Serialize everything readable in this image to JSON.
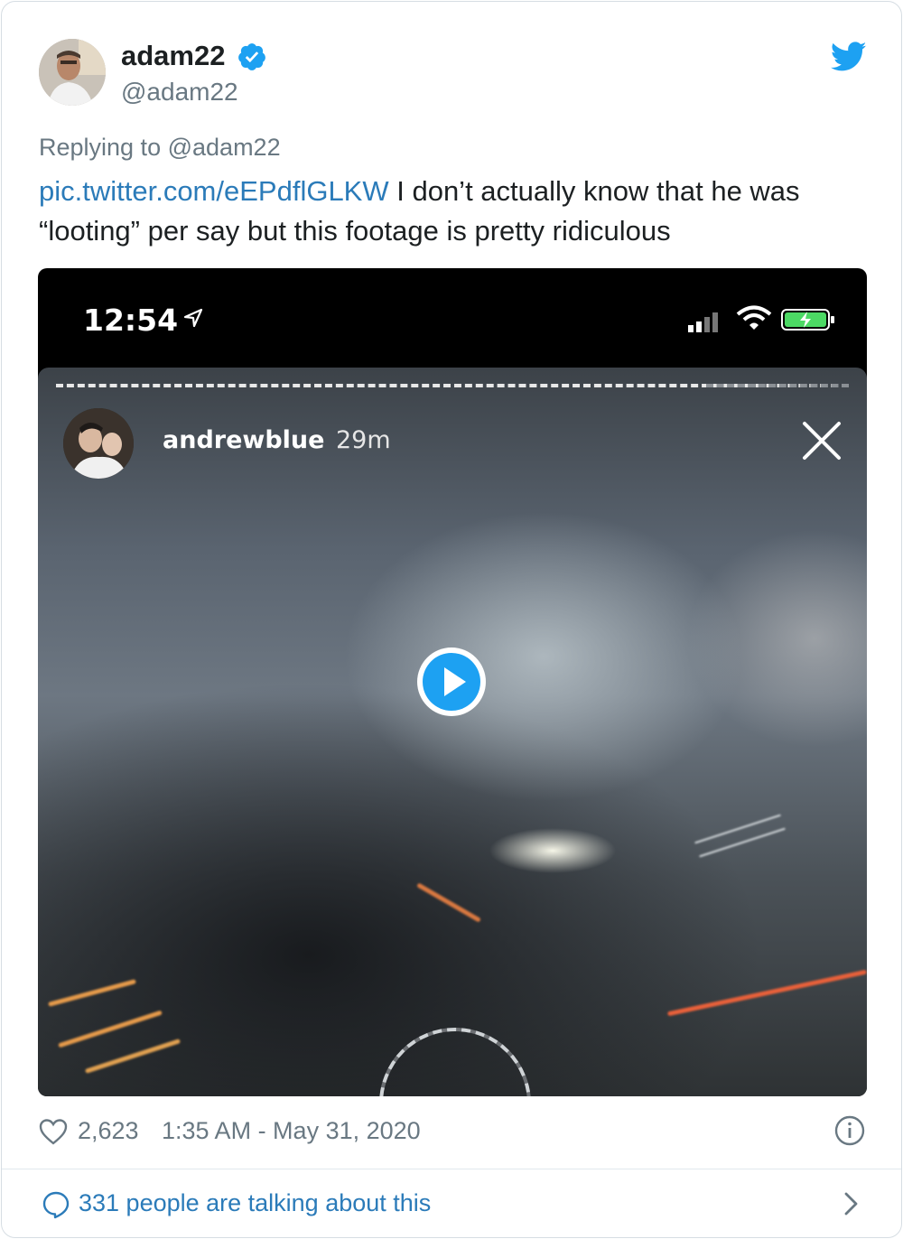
{
  "author": {
    "name": "adam22",
    "handle": "@adam22",
    "verified": true
  },
  "reply": {
    "prefix": "Replying to",
    "to": "@adam22"
  },
  "tweet": {
    "link": "pic.twitter.com/eEPdflGLKW",
    "text_line1": " I don’t actually know that he was",
    "text_line2": "“looting” per say but this footage is pretty ridiculous"
  },
  "media": {
    "status_time": "12:54",
    "story_user": "andrewblue",
    "story_age": "29m",
    "icons": [
      "location-arrow-icon",
      "signal-icon",
      "wifi-icon",
      "battery-icon",
      "close-icon",
      "play-icon"
    ]
  },
  "footer": {
    "likes": "2,623",
    "timestamp": "1:35 AM - May 31, 2020"
  },
  "conversation": {
    "label": "331 people are talking about this"
  },
  "colors": {
    "link": "#2b7bb9",
    "secondary_text": "#697882",
    "verified": "#1da1f2",
    "twitter_bird": "#1da1f2",
    "border": "#d6dde3"
  }
}
